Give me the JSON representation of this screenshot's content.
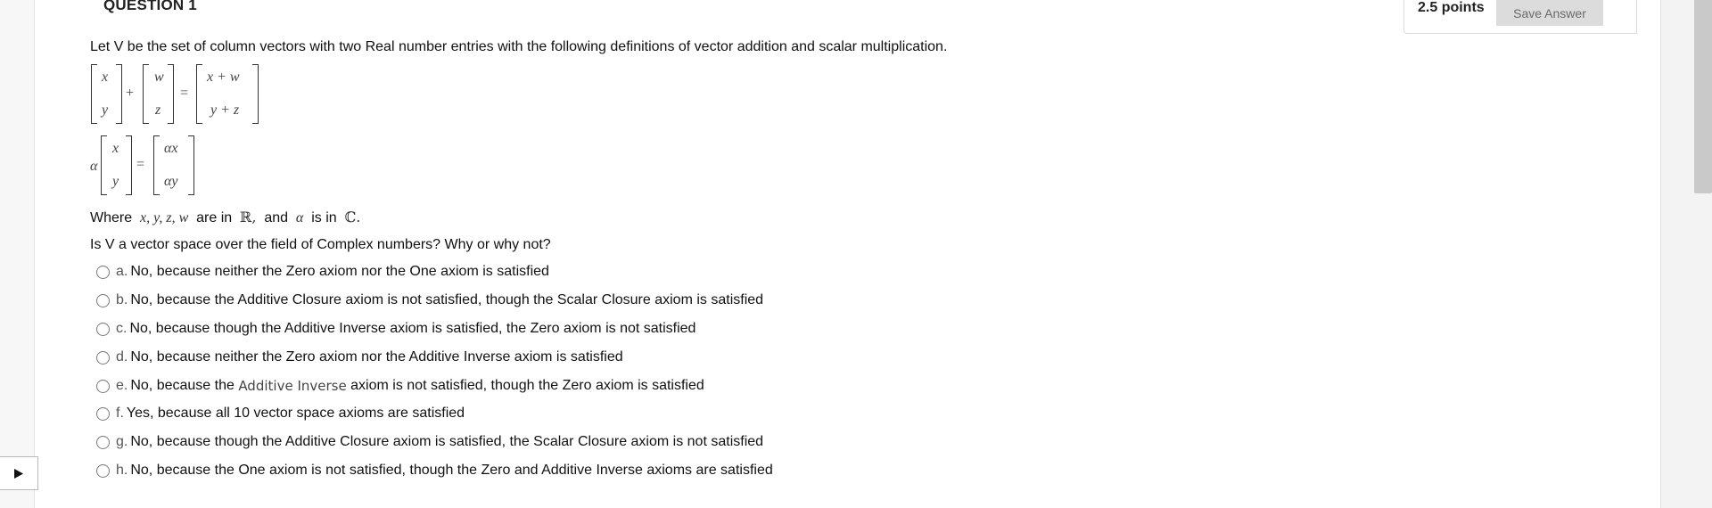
{
  "question": {
    "title": "QUESTION 1",
    "points": "2.5 points",
    "save_label": "Save Answer",
    "prompt": "Let V be the set of column vectors with two Real number entries with the following definitions of vector addition and scalar multiplication.",
    "addition": {
      "left": [
        "x",
        "y"
      ],
      "plus": "+",
      "right": [
        "w",
        "z"
      ],
      "equals": "=",
      "result": [
        "x + w",
        "y + z"
      ]
    },
    "scalar": {
      "alpha": "α",
      "vector": [
        "x",
        "y"
      ],
      "equals": "=",
      "result": [
        "αx",
        "αy"
      ]
    },
    "where": {
      "prefix": "Where",
      "vars": "x, y, z, w",
      "are_in": "are in",
      "reals": "ℝ,",
      "and": "and",
      "alpha": "α",
      "is_in": "is in",
      "complex": "ℂ."
    },
    "ask": "Is V a vector space over the field of Complex numbers?  Why or why not?",
    "options": [
      {
        "letter": "a.",
        "text": "No, because neither the Zero axiom nor the One axiom is satisfied"
      },
      {
        "letter": "b.",
        "text": "No, because the Additive Closure axiom is not satisfied, though the Scalar Closure axiom is satisfied"
      },
      {
        "letter": "c.",
        "text": "No, because though the Additive Inverse axiom is satisfied, the Zero axiom is not satisfied"
      },
      {
        "letter": "d.",
        "text": "No, because neither the Zero axiom nor the Additive Inverse axiom is satisfied"
      },
      {
        "letter": "e.",
        "text_before": "No, because the ",
        "text_accent": "Additive Inverse",
        "text_after": " axiom is not satisfied, though the Zero axiom is satisfied"
      },
      {
        "letter": "f.",
        "text": "Yes, because all 10 vector space axioms are satisfied"
      },
      {
        "letter": "g.",
        "text": "No, because though the Additive Closure axiom is satisfied, the Scalar Closure axiom is not satisfied"
      },
      {
        "letter": "h.",
        "text": "No, because the One axiom is not satisfied, though the Zero and Additive Inverse axioms are satisfied"
      }
    ]
  },
  "icons": {
    "play": "play-icon"
  },
  "colors": {
    "save_button_bg": "#dcdcdc",
    "save_button_text": "#6a6a6a"
  }
}
